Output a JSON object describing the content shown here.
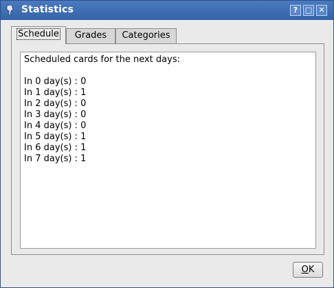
{
  "window": {
    "title": "Statistics",
    "buttons": {
      "help": "?",
      "maximize": "□",
      "close": "✕"
    }
  },
  "tabs": [
    {
      "label": "Schedule",
      "active": true
    },
    {
      "label": "Grades",
      "active": false
    },
    {
      "label": "Categories",
      "active": false
    }
  ],
  "schedule": {
    "heading": "Scheduled cards for the next days:",
    "rows": [
      "In 0 day(s) : 0",
      "In 1 day(s) : 1",
      "In 2 day(s) : 0",
      "In 3 day(s) : 0",
      "In 4 day(s) : 0",
      "In 5 day(s) : 1",
      "In 6 day(s) : 1",
      "In 7 day(s) : 1"
    ]
  },
  "footer": {
    "ok_mnemonic": "O",
    "ok_rest": "K"
  },
  "colors": {
    "titlebar": "#3b6db3",
    "background": "#eaeaea"
  }
}
